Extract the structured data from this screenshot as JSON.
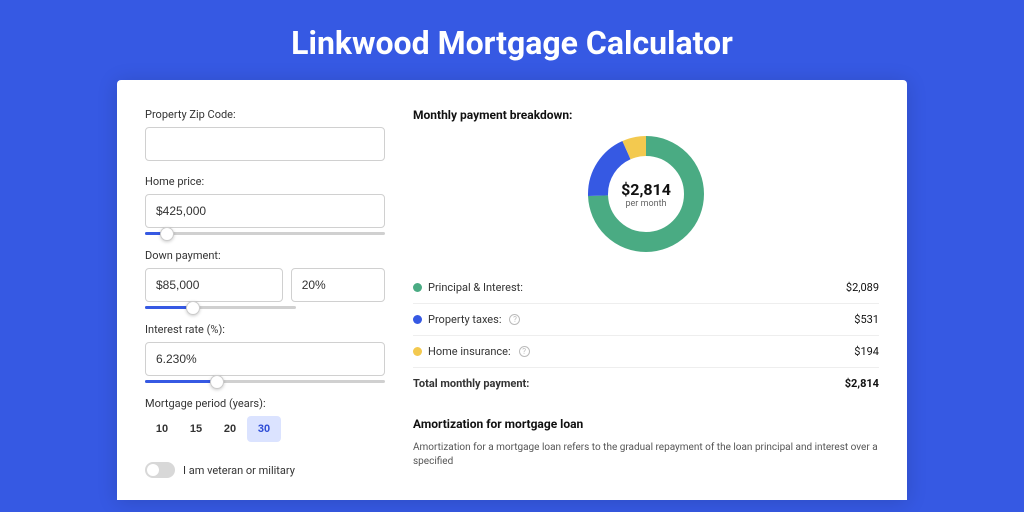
{
  "title": "Linkwood Mortgage Calculator",
  "form": {
    "zip_label": "Property Zip Code:",
    "zip_value": "",
    "price_label": "Home price:",
    "price_value": "$425,000",
    "price_slider_pct": 9,
    "down_label": "Down payment:",
    "down_value": "$85,000",
    "down_pct_value": "20%",
    "down_slider_pct": 20,
    "rate_label": "Interest rate (%):",
    "rate_value": "6.230%",
    "rate_slider_pct": 30,
    "period_label": "Mortgage period (years):",
    "periods": [
      "10",
      "15",
      "20",
      "30"
    ],
    "period_selected": "30",
    "veteran_label": "I am veteran or military"
  },
  "breakdown": {
    "heading": "Monthly payment breakdown:",
    "center_amount": "$2,814",
    "center_sub": "per month",
    "rows": [
      {
        "label": "Principal & Interest:",
        "value": "$2,089",
        "color": "#4aab83",
        "info": false
      },
      {
        "label": "Property taxes:",
        "value": "$531",
        "color": "#3659e3",
        "info": true
      },
      {
        "label": "Home insurance:",
        "value": "$194",
        "color": "#f3c94f",
        "info": true
      }
    ],
    "total_label": "Total monthly payment:",
    "total_value": "$2,814"
  },
  "amortization": {
    "title": "Amortization for mortgage loan",
    "text": "Amortization for a mortgage loan refers to the gradual repayment of the loan principal and interest over a specified"
  },
  "chart_data": {
    "type": "pie",
    "title": "Monthly payment breakdown",
    "series": [
      {
        "name": "Principal & Interest",
        "value": 2089,
        "color": "#4aab83"
      },
      {
        "name": "Property taxes",
        "value": 531,
        "color": "#3659e3"
      },
      {
        "name": "Home insurance",
        "value": 194,
        "color": "#f3c94f"
      }
    ],
    "total": 2814,
    "center_label": "$2,814 per month"
  }
}
